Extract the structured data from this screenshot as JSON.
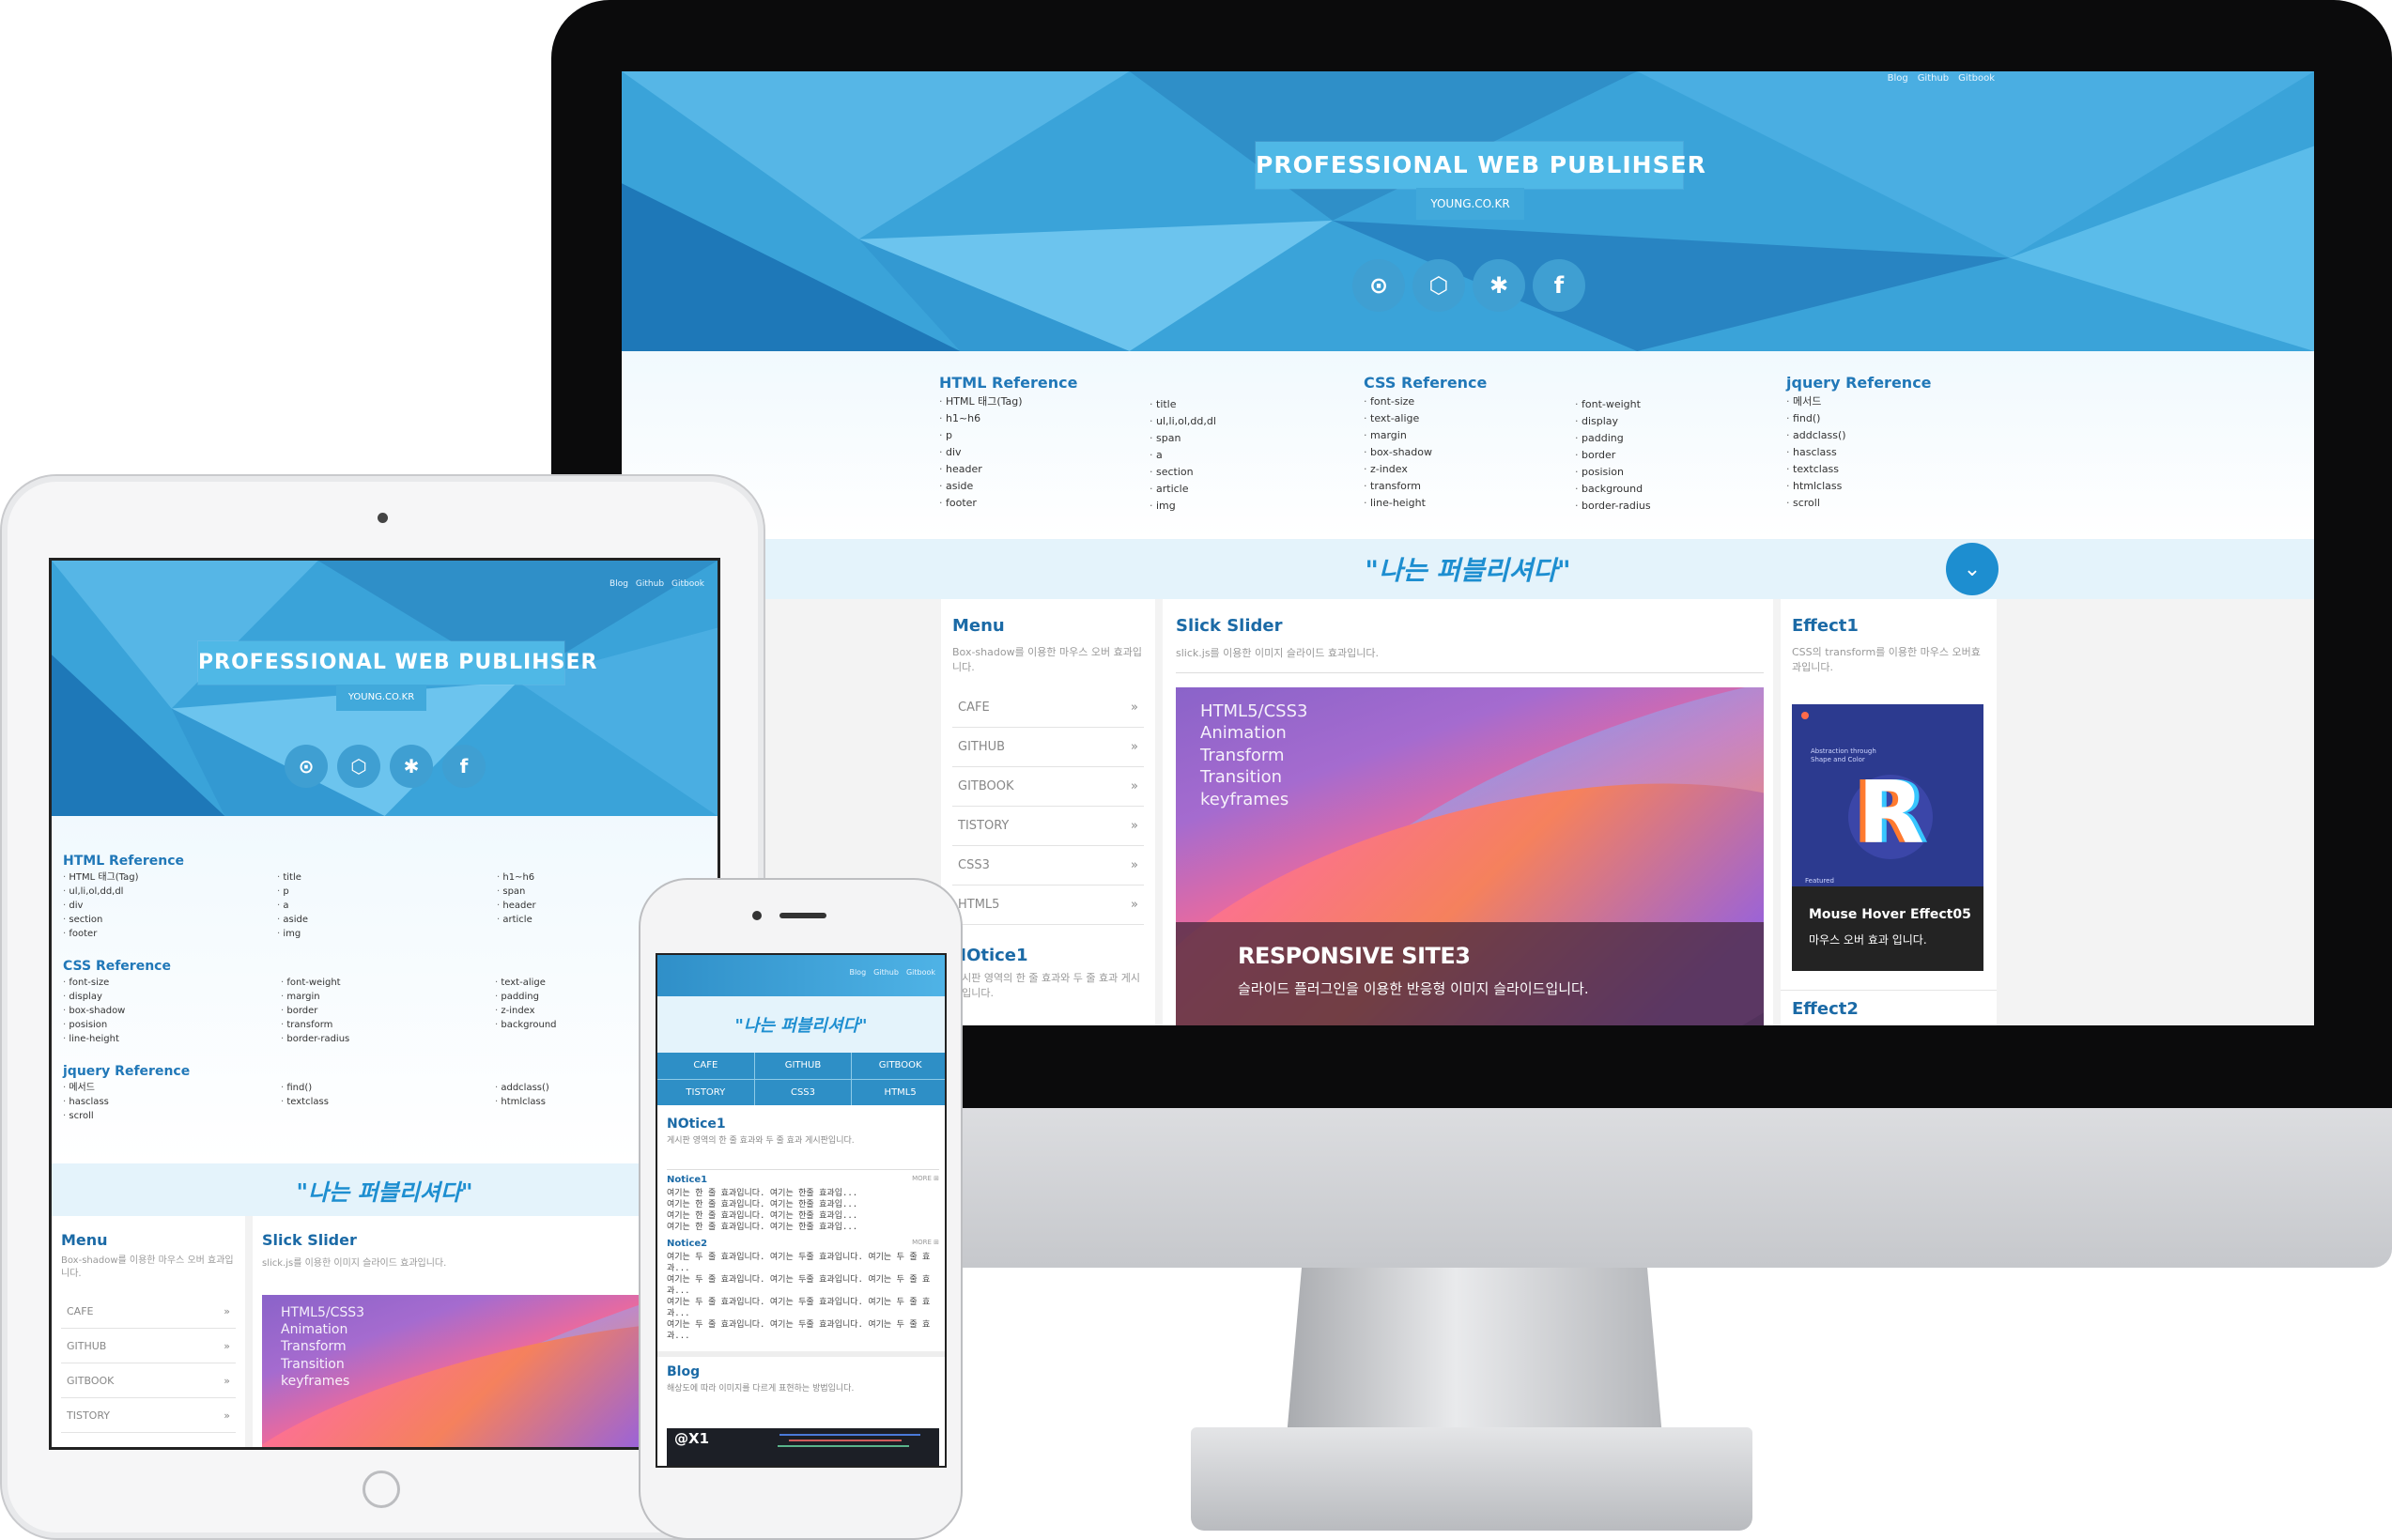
{
  "site": {
    "top_nav": [
      "Blog",
      "Github",
      "Gitbook"
    ],
    "title": "PROFESSIONAL WEB PUBLIHSER",
    "subtitle": "YOUNG.CO.KR",
    "social_icons": [
      "github-icon",
      "codepen-icon",
      "puzzle-icon",
      "facebook-icon"
    ],
    "slogan": "\"나는 퍼블리셔다\"",
    "colors": {
      "hero": "#3aa3d9",
      "accent": "#1b6aa6",
      "banner": "#e4f3fb",
      "scroll_button": "#1d8ed0"
    }
  },
  "references": {
    "html": {
      "title": "HTML Reference",
      "col1": [
        "HTML 태그(Tag)",
        "h1~h6",
        "p",
        "div",
        "header",
        "aside",
        "footer"
      ],
      "col2": [
        "title",
        "ul,li,ol,dd,dl",
        "span",
        "a",
        "section",
        "article",
        "img"
      ]
    },
    "css": {
      "title": "CSS Reference",
      "col1": [
        "font-size",
        "text-alige",
        "margin",
        "box-shadow",
        "z-index",
        "transform",
        "line-height"
      ],
      "col2": [
        "font-weight",
        "display",
        "padding",
        "border",
        "posision",
        "background",
        "border-radius"
      ]
    },
    "jquery": {
      "title": "jquery Reference",
      "col1": [
        "메서드",
        "find()",
        "addclass()",
        "hasclass",
        "textclass",
        "htmlclass",
        "scroll"
      ]
    }
  },
  "tablet_refs": {
    "html": {
      "title": "HTML Reference",
      "c1": [
        "HTML 태그(Tag)",
        "ul,li,ol,dd,dl",
        "div",
        "section",
        "footer"
      ],
      "c2": [
        "title",
        "p",
        "a",
        "aside",
        "img"
      ],
      "c3": [
        "h1~h6",
        "span",
        "header",
        "article"
      ]
    },
    "css": {
      "title": "CSS Reference",
      "c1": [
        "font-size",
        "display",
        "box-shadow",
        "posision",
        "line-height"
      ],
      "c2": [
        "font-weight",
        "margin",
        "border",
        "transform",
        "border-radius"
      ],
      "c3": [
        "text-alige",
        "padding",
        "z-index",
        "background"
      ]
    },
    "jquery": {
      "title": "jquery Reference",
      "c1": [
        "메서드",
        "hasclass",
        "scroll"
      ],
      "c2": [
        "find()",
        "textclass"
      ],
      "c3": [
        "addclass()",
        "htmlclass"
      ]
    }
  },
  "menu": {
    "title": "Menu",
    "desc": "Box-shadow를 이용한 마우스 오버 효과입니다.",
    "items": [
      "CAFE",
      "GITHUB",
      "GITBOOK",
      "TISTORY",
      "CSS3",
      "HTML5"
    ],
    "arrow": "»"
  },
  "notice": {
    "title": "NOtice1",
    "desc": "게시판 영역의 한 줄 효과와 두 줄 효과 게시판입니다."
  },
  "slider": {
    "title": "Slick Slider",
    "desc": "slick.js를 이용한 이미지 슬라이드 효과입니다.",
    "overlay_lines": [
      "HTML5/CSS3",
      "Animation",
      "Transform",
      "Transition",
      "keyframes"
    ],
    "caption_title": "RESPONSIVE SITE3",
    "caption_desc": "슬라이드 플러그인을 이용한 반응형 이미지 슬라이드입니다."
  },
  "effect1": {
    "title": "Effect1",
    "desc": "CSS의 transform를 이용한 마우스 오버효과입니다.",
    "card_title": "Mouse Hover Effect05",
    "card_desc": "마우스 오버 효과 입니다.",
    "poster_text": "Abstraction through Shape and Color",
    "poster_letter": "R",
    "poster_tag": "Featured"
  },
  "effect2": {
    "title": "Effect2"
  },
  "phone": {
    "tabs": [
      "CAFE",
      "GITHUB",
      "GITBOOK",
      "TISTORY",
      "CSS3",
      "HTML5"
    ],
    "notice_title": "NOtice1",
    "notice_desc": "게시판 영역의 한 줄 효과와 두 줄 효과 게시판입니다.",
    "notice1": {
      "title": "Notice1",
      "more": "MORE ⊞",
      "items": [
        "여기는 한 줄 효과입니다. 여기는 한줄 효과입...",
        "여기는 한 줄 효과입니다. 여기는 한줄 효과입...",
        "여기는 한 줄 효과입니다. 여기는 한줄 효과입...",
        "여기는 한 줄 효과입니다. 여기는 한줄 효과입..."
      ]
    },
    "notice2": {
      "title": "Notice2",
      "more": "MORE ⊞",
      "items": [
        "여기는 두 줄 효과입니다. 여기는 두줄 효과입니다. 여기는 두 줄 효과...",
        "여기는 두 줄 효과입니다. 여기는 두줄 효과입니다. 여기는 두 줄 효과...",
        "여기는 두 줄 효과입니다. 여기는 두줄 효과입니다. 여기는 두 줄 효과...",
        "여기는 두 줄 효과입니다. 여기는 두줄 효과입니다. 여기는 두 줄 효과..."
      ]
    },
    "blog_title": "Blog",
    "blog_desc": "해상도에 따라 이미지를 다르게 표현하는 방법입니다.",
    "blog_badge": "@X1"
  }
}
